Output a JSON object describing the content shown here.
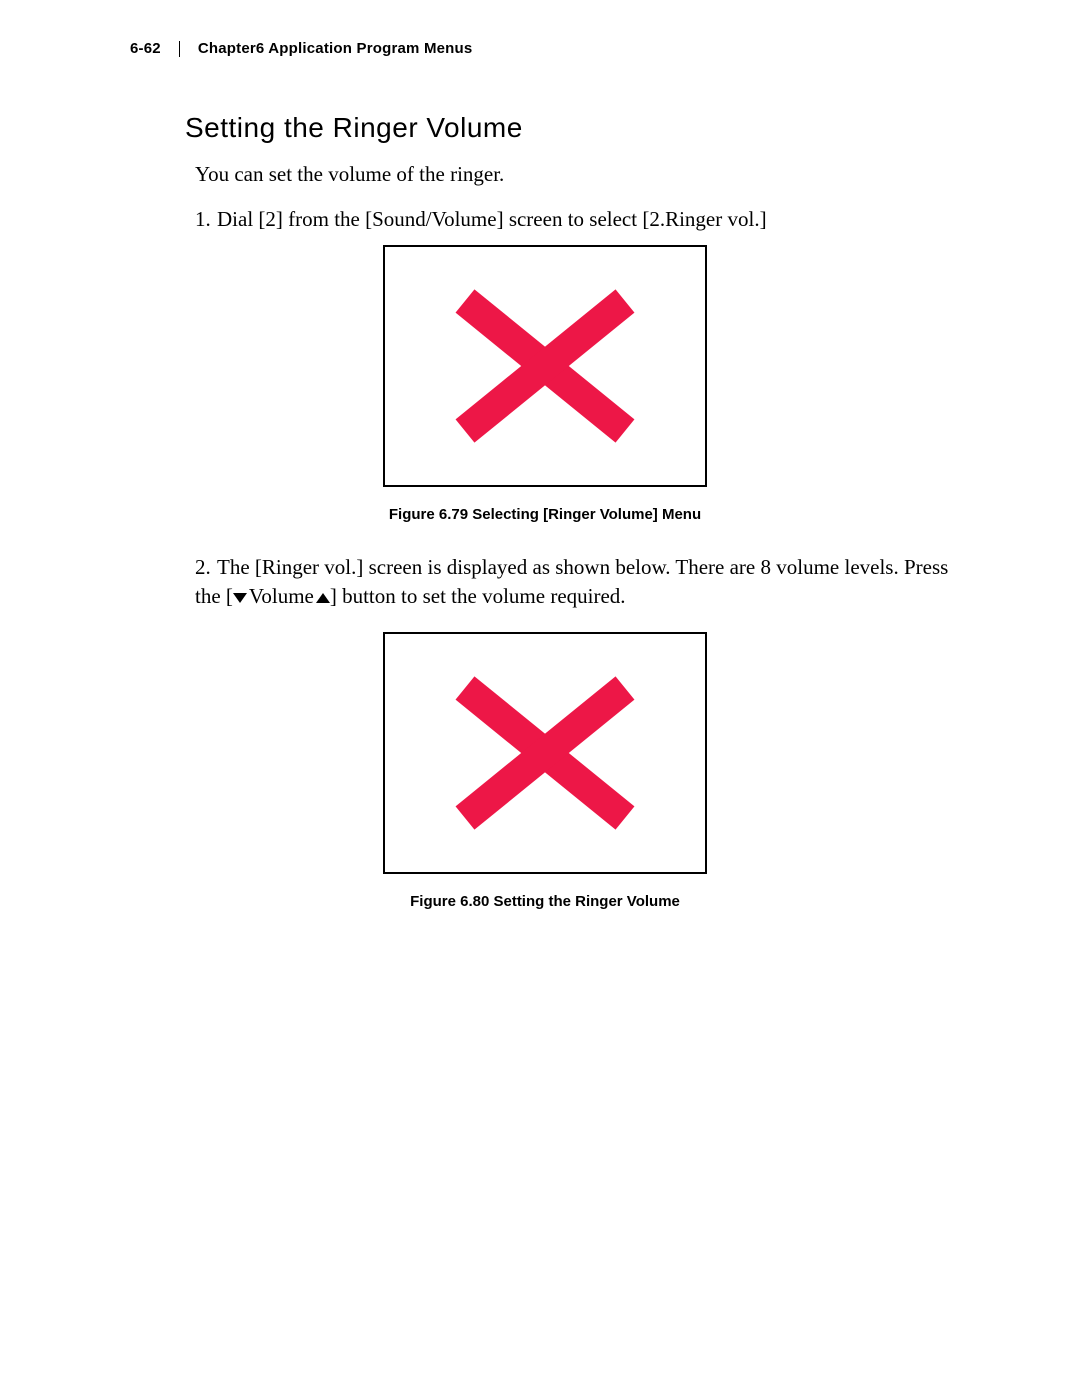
{
  "header": {
    "page_num": "6-62",
    "chapter": "Chapter6  Application Program Menus"
  },
  "section_title": "Setting the Ringer Volume",
  "intro": "You can set the volume of the ringer.",
  "step1": {
    "num": "1.",
    "text": "Dial [2] from the [Sound/Volume] screen to select [2.Ringer vol.]"
  },
  "figure1_caption": "Figure 6.79  Selecting [Ringer Volume] Menu",
  "step2": {
    "num": "2.",
    "text_a": "The [Ringer vol.] screen is displayed as shown below. There are 8 volume levels. Press the [",
    "vol_label": "Volume",
    "text_b": "] button to set the volume required."
  },
  "figure2_caption": "Figure 6.80  Setting the Ringer Volume"
}
